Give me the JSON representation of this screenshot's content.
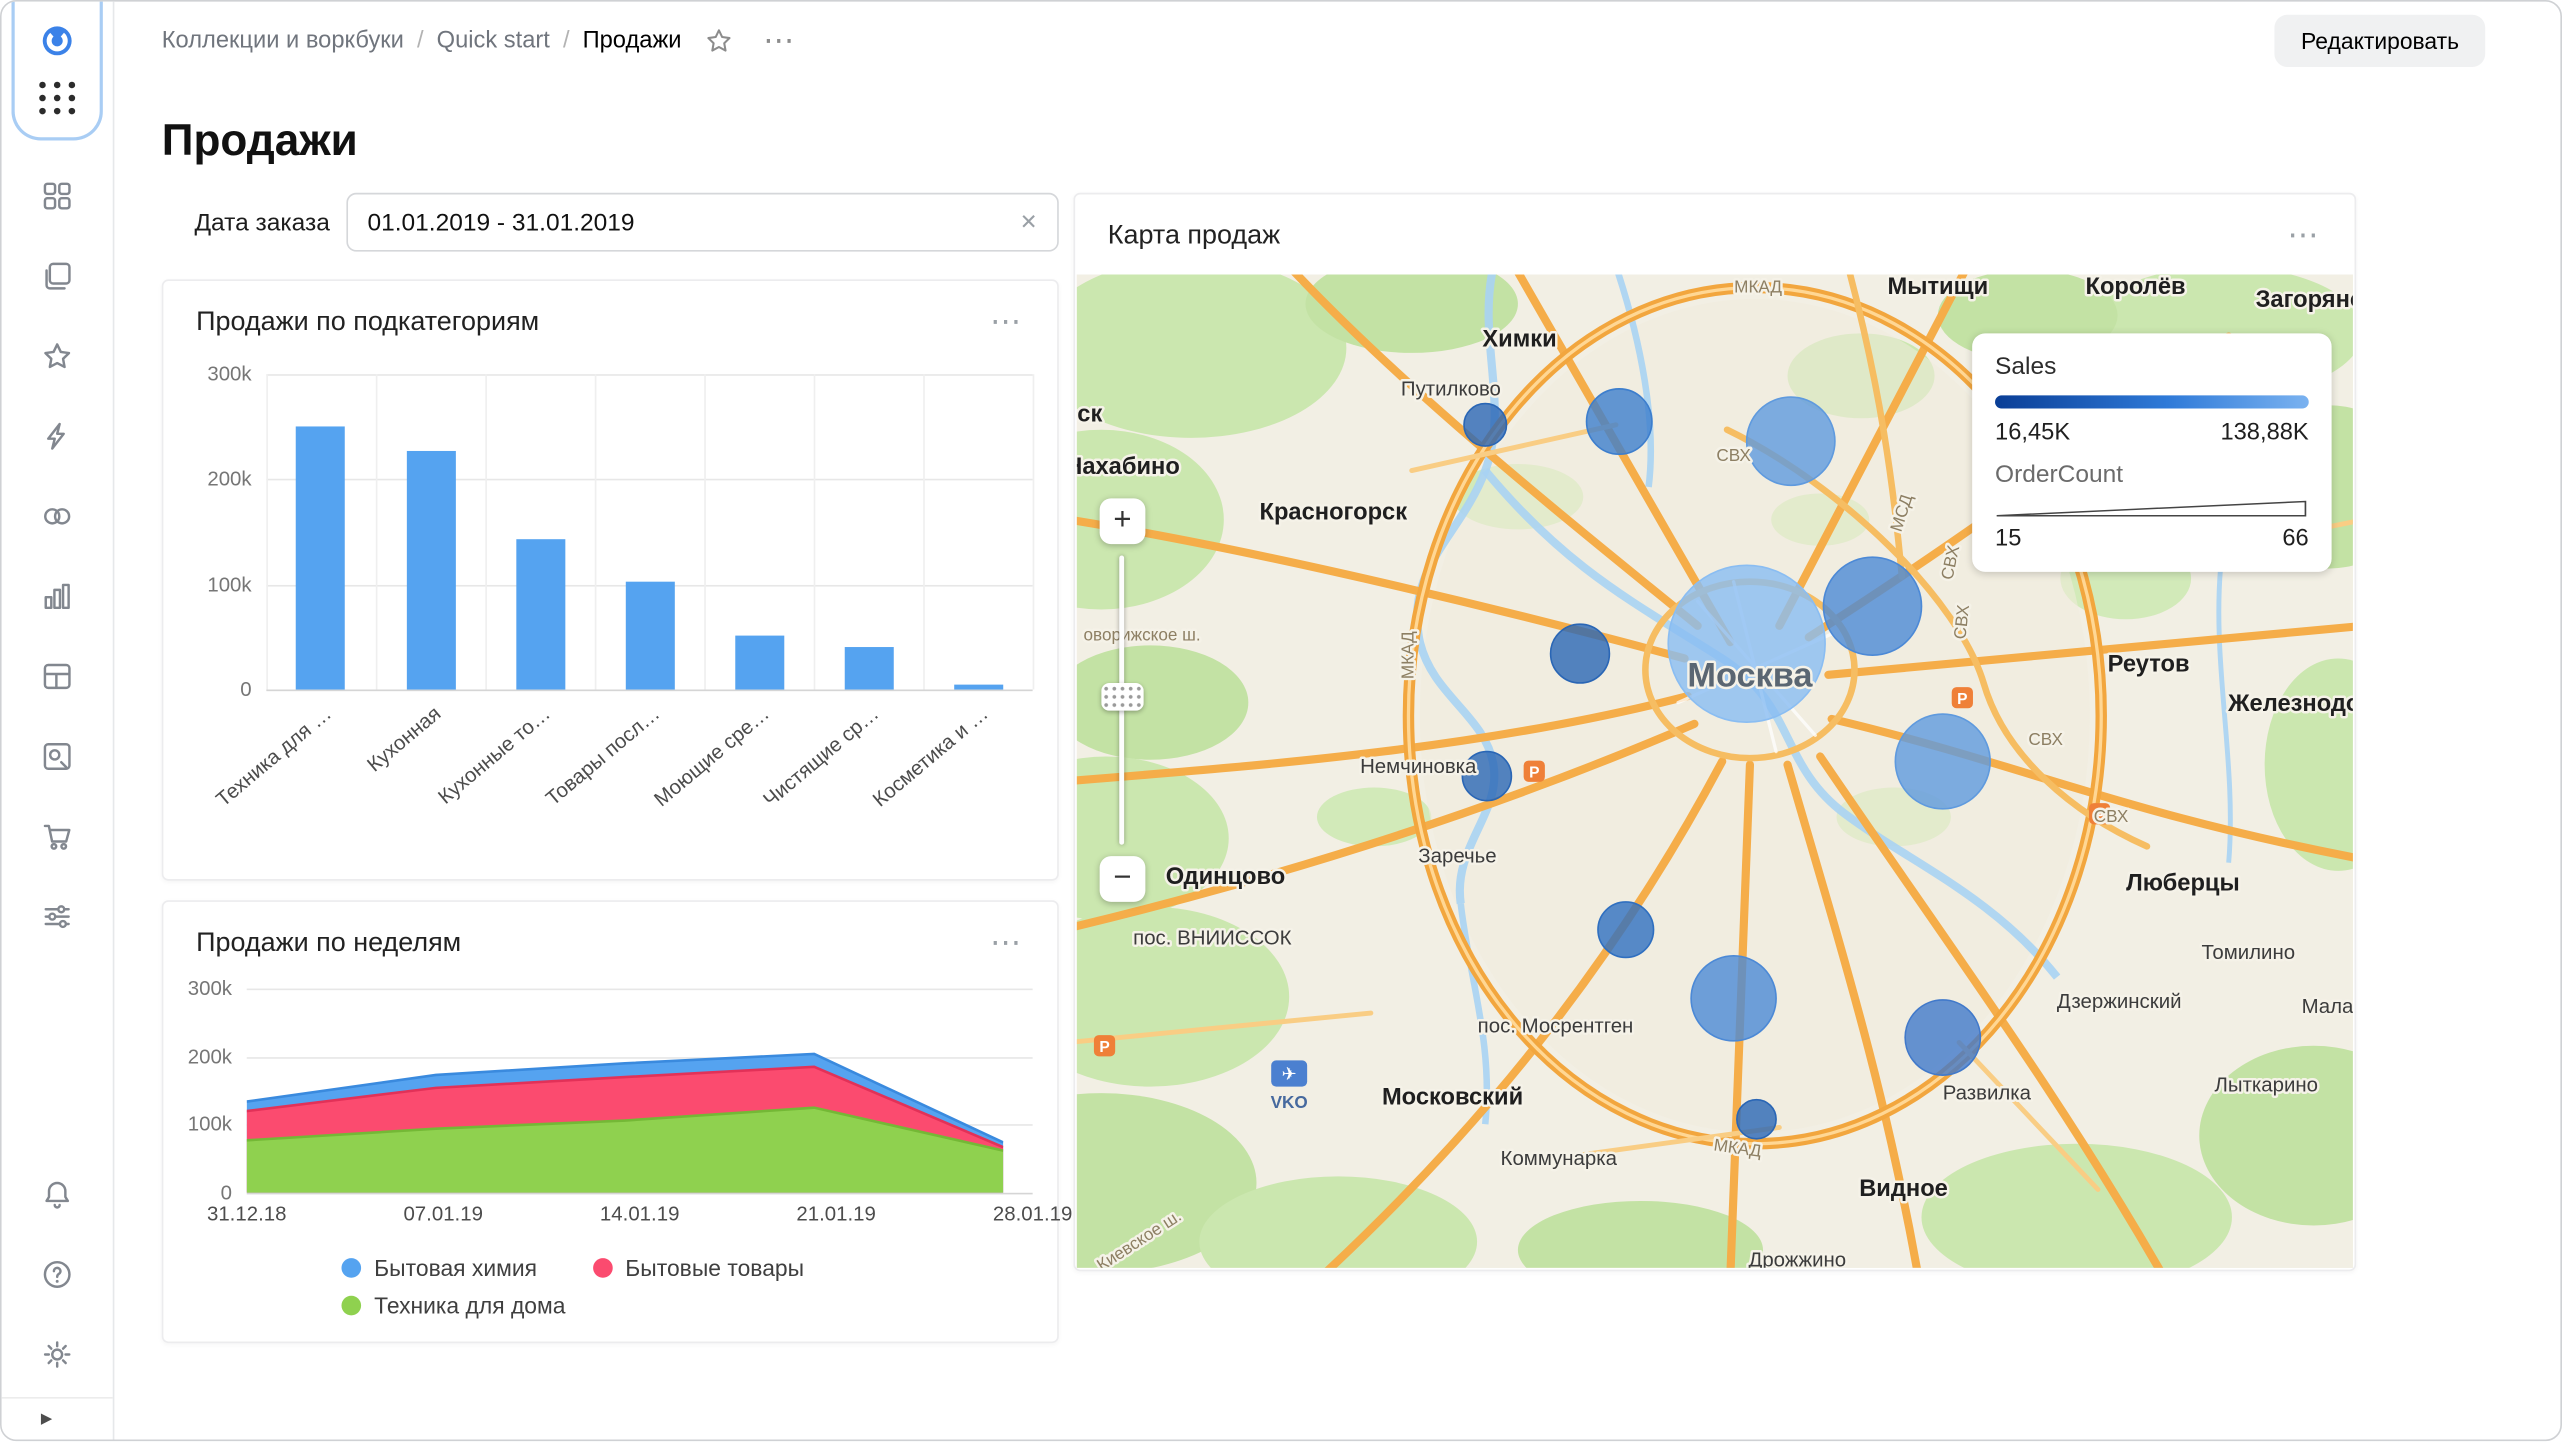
{
  "window": {
    "edit_button": "Редактировать"
  },
  "breadcrumb": {
    "items": [
      "Коллекции и воркбуки",
      "Quick start",
      "Продажи"
    ]
  },
  "page": {
    "title": "Продажи"
  },
  "filter": {
    "label": "Дата заказа",
    "value": "01.01.2019 - 31.01.2019",
    "clear_icon": "✕"
  },
  "sidebar": {
    "icons": [
      "collections",
      "workbooks",
      "favorites",
      "connections",
      "datasets",
      "charts",
      "dashboards",
      "editor",
      "marketplace",
      "services"
    ],
    "footer_icons": [
      "notifications",
      "help",
      "settings"
    ],
    "collapse_icon": "expand"
  },
  "chart_data": [
    {
      "type": "bar",
      "title": "Продажи по подкатегориям",
      "categories": [
        "Техника для …",
        "Кухонная",
        "Кухонные то…",
        "Товары посл…",
        "Моющие сре…",
        "Чистящие ср…",
        "Косметика и …"
      ],
      "values": [
        250000,
        227000,
        143000,
        103000,
        52000,
        41000,
        5000
      ],
      "ylim": [
        0,
        300000
      ],
      "yticks": [
        "300k",
        "200k",
        "100k",
        "0"
      ],
      "bar_color": "#55a3f0"
    },
    {
      "type": "area",
      "title": "Продажи по неделям",
      "x": [
        "31.12.18",
        "07.01.19",
        "14.01.19",
        "21.01.19",
        "28.01.19"
      ],
      "ylim": [
        0,
        300000
      ],
      "yticks": [
        "300k",
        "200k",
        "100k",
        "0"
      ],
      "series": [
        {
          "name": "Техника для дома",
          "color": "#8fd14f",
          "stroke": "#74b836",
          "values": [
            77000,
            94000,
            106000,
            125000,
            62000
          ]
        },
        {
          "name": "Бытовые товары",
          "color": "#fb4b6f",
          "stroke": "#e23158",
          "values": [
            43000,
            60000,
            64000,
            60000,
            5000
          ]
        },
        {
          "name": "Бытовая химия",
          "color": "#55a3f0",
          "stroke": "#3a8ade",
          "values": [
            14000,
            19000,
            20000,
            19000,
            7000
          ]
        }
      ],
      "legend": [
        {
          "label": "Бытовая химия",
          "color": "#55a3f0"
        },
        {
          "label": "Бытовые товары",
          "color": "#fb4b6f"
        },
        {
          "label": "Техника для дома",
          "color": "#8fd14f"
        }
      ]
    },
    {
      "type": "map",
      "title": "Карта продаж",
      "legend": {
        "sales_label": "Sales",
        "sales_min": "16,45K",
        "sales_max": "138,88K",
        "orders_label": "OrderCount",
        "orders_min": "15",
        "orders_max": "66"
      },
      "zoom": {
        "in": "+",
        "out": "−"
      },
      "labels": [
        {
          "text": "Химки",
          "x": 271,
          "y": 44,
          "cls": "town"
        },
        {
          "text": "Мытищи",
          "x": 527,
          "y": 12,
          "cls": "town"
        },
        {
          "text": "Королёв",
          "x": 648,
          "y": 12,
          "cls": "town"
        },
        {
          "text": "Загорянск",
          "x": 758,
          "y": 20,
          "cls": "town"
        },
        {
          "text": "Путилково",
          "x": 229,
          "y": 74,
          "cls": "small"
        },
        {
          "text": "ск",
          "x": 8,
          "y": 90,
          "cls": "town"
        },
        {
          "text": "Нахабино",
          "x": 28,
          "y": 122,
          "cls": "town"
        },
        {
          "text": "Красногорск",
          "x": 157,
          "y": 150,
          "cls": "town"
        },
        {
          "text": "Реутов",
          "x": 656,
          "y": 243,
          "cls": "town"
        },
        {
          "text": "Железнодоро",
          "x": 754,
          "y": 267,
          "cls": "town"
        },
        {
          "text": "Немчиновка",
          "x": 209,
          "y": 305,
          "cls": "small"
        },
        {
          "text": "Заречье",
          "x": 233,
          "y": 360,
          "cls": "small"
        },
        {
          "text": "Одинцово",
          "x": 91,
          "y": 373,
          "cls": "town"
        },
        {
          "text": "пос. ВНИИССОК",
          "x": 83,
          "y": 410,
          "cls": "small"
        },
        {
          "text": "Люберцы",
          "x": 677,
          "y": 377,
          "cls": "town"
        },
        {
          "text": "Томилино",
          "x": 717,
          "y": 419,
          "cls": "small"
        },
        {
          "text": "Дзержинский",
          "x": 638,
          "y": 449,
          "cls": "small"
        },
        {
          "text": "Малахо",
          "x": 772,
          "y": 452,
          "cls": "small"
        },
        {
          "text": "пос. Мосрентген",
          "x": 293,
          "y": 464,
          "cls": "small"
        },
        {
          "text": "Московский",
          "x": 230,
          "y": 508,
          "cls": "town"
        },
        {
          "text": "Развилка",
          "x": 557,
          "y": 505,
          "cls": "small"
        },
        {
          "text": "Лыткарино",
          "x": 728,
          "y": 500,
          "cls": "small"
        },
        {
          "text": "Коммунарка",
          "x": 295,
          "y": 545,
          "cls": "small"
        },
        {
          "text": "Видное",
          "x": 506,
          "y": 564,
          "cls": "town"
        },
        {
          "text": "Дрожжино",
          "x": 441,
          "y": 607,
          "cls": "small"
        },
        {
          "text": "Москва",
          "x": 412,
          "y": 252,
          "cls": "city"
        },
        {
          "text": "МКАД",
          "x": 417,
          "y": 11,
          "cls": "road"
        },
        {
          "text": "МКАД",
          "x": 206,
          "y": 233,
          "cls": "road",
          "rot": -90
        },
        {
          "text": "МКАД",
          "x": 404,
          "y": 538,
          "cls": "road",
          "rot": 8
        },
        {
          "text": "МСД",
          "x": 508,
          "y": 147,
          "cls": "road",
          "rot": -72
        },
        {
          "text": "СВХ",
          "x": 402,
          "y": 114,
          "cls": "road"
        },
        {
          "text": "СВХ",
          "x": 538,
          "y": 177,
          "cls": "road",
          "rot": -78
        },
        {
          "text": "СВХ",
          "x": 545,
          "y": 213,
          "cls": "road",
          "rot": -84
        },
        {
          "text": "СВХ",
          "x": 593,
          "y": 288,
          "cls": "road"
        },
        {
          "text": "СВХ",
          "x": 633,
          "y": 335,
          "cls": "road"
        },
        {
          "text": "оворижское ш.",
          "x": 40,
          "y": 224,
          "cls": "road"
        },
        {
          "text": "Киевское ш.",
          "x": 40,
          "y": 594,
          "cls": "road",
          "rot": -33
        }
      ],
      "bubbles": [
        {
          "x": 250,
          "y": 92,
          "r": 13,
          "c": "#2a66b5"
        },
        {
          "x": 332,
          "y": 90,
          "r": 20,
          "c": "#3d7ecd"
        },
        {
          "x": 437,
          "y": 102,
          "r": 27,
          "c": "#5f9ade"
        },
        {
          "x": 410,
          "y": 226,
          "r": 48,
          "c": "#8abdf2"
        },
        {
          "x": 487,
          "y": 203,
          "r": 30,
          "c": "#4c89d6"
        },
        {
          "x": 308,
          "y": 232,
          "r": 18,
          "c": "#2a66b5"
        },
        {
          "x": 251,
          "y": 307,
          "r": 15,
          "c": "#2a66b5"
        },
        {
          "x": 530,
          "y": 298,
          "r": 29,
          "c": "#5f9ade"
        },
        {
          "x": 336,
          "y": 401,
          "r": 17,
          "c": "#2f6fc0"
        },
        {
          "x": 402,
          "y": 443,
          "r": 26,
          "c": "#4c89d6"
        },
        {
          "x": 530,
          "y": 467,
          "r": 23,
          "c": "#4179ca"
        },
        {
          "x": 416,
          "y": 517,
          "r": 12,
          "c": "#2a66b5"
        }
      ],
      "poi": [
        {
          "kind": "parking",
          "x": 542,
          "y": 259
        },
        {
          "kind": "parking",
          "x": 280,
          "y": 304
        },
        {
          "kind": "parking",
          "x": 626,
          "y": 330
        },
        {
          "kind": "parking",
          "x": 17,
          "y": 472
        },
        {
          "kind": "airport",
          "x": 130,
          "y": 489,
          "label": "VKO"
        }
      ]
    }
  ]
}
